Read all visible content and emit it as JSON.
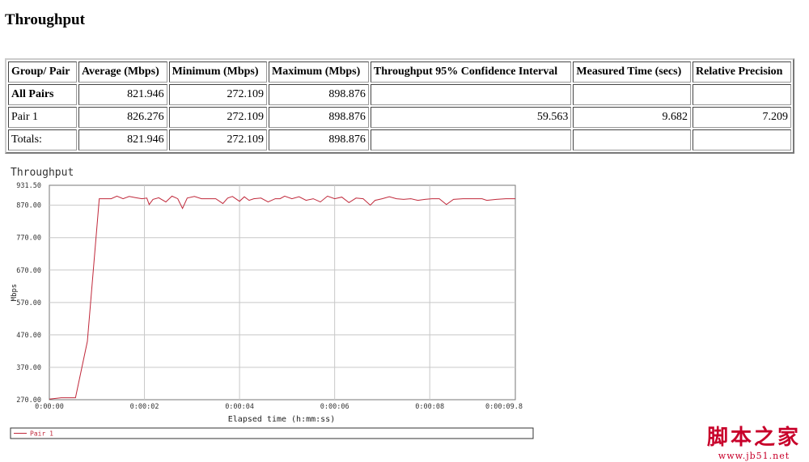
{
  "page": {
    "title": "Throughput"
  },
  "table": {
    "headers": [
      "Group/ Pair",
      "Average (Mbps)",
      "Minimum (Mbps)",
      "Maximum (Mbps)",
      "Throughput 95% Confidence Interval",
      "Measured Time (secs)",
      "Relative Precision"
    ],
    "rows": [
      {
        "label": "All Pairs",
        "bold": true,
        "cells": [
          "821.946",
          "272.109",
          "898.876",
          "",
          "",
          ""
        ]
      },
      {
        "label": "Pair 1",
        "bold": false,
        "cells": [
          "826.276",
          "272.109",
          "898.876",
          "59.563",
          "9.682",
          "7.209"
        ]
      },
      {
        "label": "Totals:",
        "bold": false,
        "cells": [
          "821.946",
          "272.109",
          "898.876",
          "",
          "",
          ""
        ]
      }
    ]
  },
  "chart_data": {
    "type": "line",
    "title": "Throughput",
    "xlabel": "Elapsed time (h:mm:ss)",
    "ylabel": "Mbps",
    "ylim": [
      270.0,
      931.5
    ],
    "y_ticks": [
      "931.50",
      "870.00",
      "770.00",
      "670.00",
      "570.00",
      "470.00",
      "370.00",
      "270.00"
    ],
    "y_tick_values": [
      931.5,
      870,
      770,
      670,
      570,
      470,
      370,
      270
    ],
    "xlim": [
      0,
      9.8
    ],
    "x_ticks": [
      "0:00:00",
      "0:00:02",
      "0:00:04",
      "0:00:06",
      "0:00:08",
      "0:00:09.8"
    ],
    "x_tick_values": [
      0,
      2,
      4,
      6,
      8,
      9.8
    ],
    "grid": true,
    "legend_position": "bottom",
    "series": [
      {
        "name": "Pair 1",
        "color": "#c0283a",
        "x": [
          0,
          0.25,
          0.55,
          0.8,
          1.05,
          1.3,
          1.42,
          1.55,
          1.68,
          1.82,
          1.95,
          2.05,
          2.1,
          2.18,
          2.3,
          2.45,
          2.58,
          2.7,
          2.8,
          2.9,
          3.05,
          3.2,
          3.35,
          3.5,
          3.65,
          3.75,
          3.85,
          4.0,
          4.1,
          4.2,
          4.3,
          4.45,
          4.6,
          4.75,
          4.85,
          4.95,
          5.1,
          5.25,
          5.4,
          5.55,
          5.7,
          5.85,
          6.0,
          6.15,
          6.3,
          6.45,
          6.6,
          6.75,
          6.85,
          7.0,
          7.15,
          7.3,
          7.45,
          7.6,
          7.75,
          7.9,
          8.05,
          8.2,
          8.35,
          8.5,
          8.7,
          8.9,
          9.0,
          9.1,
          9.2,
          9.4,
          9.6,
          9.8
        ],
        "y": [
          272,
          276,
          276,
          450,
          890,
          890,
          898,
          890,
          897,
          893,
          890,
          892,
          872,
          888,
          893,
          880,
          898,
          890,
          860,
          892,
          897,
          890,
          890,
          890,
          875,
          892,
          897,
          882,
          896,
          885,
          890,
          892,
          880,
          890,
          890,
          898,
          890,
          896,
          885,
          890,
          880,
          898,
          890,
          895,
          878,
          892,
          890,
          870,
          885,
          890,
          896,
          890,
          888,
          890,
          885,
          888,
          890,
          890,
          872,
          888,
          890,
          890,
          890,
          890,
          885,
          888,
          890,
          890
        ]
      }
    ]
  },
  "watermark": {
    "main": "脚本之家",
    "url": "www.jb51.net"
  }
}
